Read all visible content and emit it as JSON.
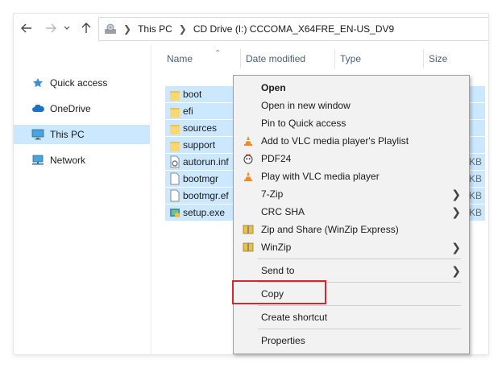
{
  "address_bar": {
    "crumbs": [
      "This PC",
      "CD Drive (I:) CCCOMA_X64FRE_EN-US_DV9"
    ]
  },
  "sidebar": {
    "items": [
      {
        "label": "Quick access",
        "icon": "star-icon"
      },
      {
        "label": "OneDrive",
        "icon": "cloud-icon"
      },
      {
        "label": "This PC",
        "icon": "monitor-icon",
        "selected": true
      },
      {
        "label": "Network",
        "icon": "network-icon"
      }
    ]
  },
  "columns": {
    "name": "Name",
    "date_modified": "Date modified",
    "type": "Type",
    "size": "Size"
  },
  "files": [
    {
      "name": "boot",
      "icon": "folder-icon",
      "size": ""
    },
    {
      "name": "efi",
      "icon": "folder-icon",
      "size": ""
    },
    {
      "name": "sources",
      "icon": "folder-icon",
      "size": ""
    },
    {
      "name": "support",
      "icon": "folder-icon",
      "size": ""
    },
    {
      "name": "autorun.inf",
      "icon": "settings-file-icon",
      "size": "KB"
    },
    {
      "name": "bootmgr",
      "icon": "file-icon",
      "size": "KB"
    },
    {
      "name": "bootmgr.ef",
      "icon": "file-icon",
      "size": "KB"
    },
    {
      "name": "setup.exe",
      "icon": "setup-icon",
      "size": "KB"
    }
  ],
  "context_menu": {
    "items": [
      {
        "label": "Open"
      },
      {
        "label": "Open in new window"
      },
      {
        "label": "Pin to Quick access"
      },
      {
        "label": "Add to VLC media player's Playlist"
      },
      {
        "label": "PDF24"
      },
      {
        "label": "Play with VLC media player"
      },
      {
        "label": "7-Zip"
      },
      {
        "label": "CRC SHA"
      },
      {
        "label": "Zip and Share (WinZip Express)"
      },
      {
        "label": "WinZip"
      },
      {
        "label": "Send to"
      },
      {
        "label": "Copy"
      },
      {
        "label": "Create shortcut"
      },
      {
        "label": "Properties"
      }
    ]
  },
  "colors": {
    "selection": "#cce8ff",
    "highlight_border": "#d7262e",
    "menu_bg": "#f2f2f2"
  }
}
